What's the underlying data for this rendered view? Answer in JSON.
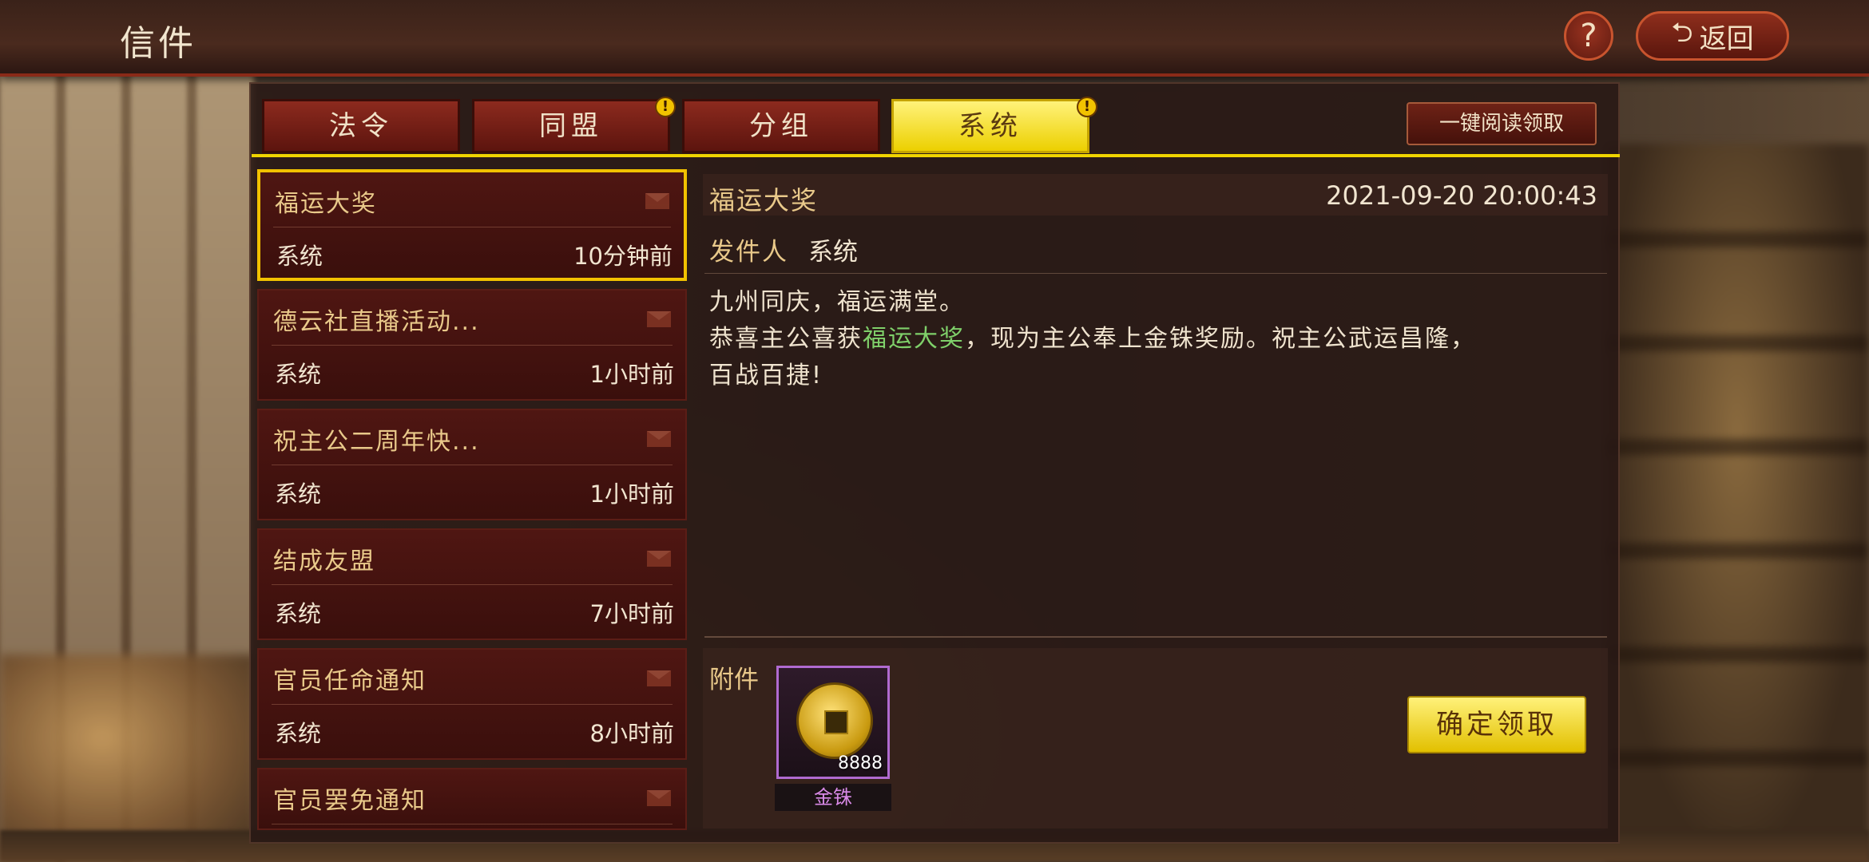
{
  "header": {
    "title": "信件",
    "help_label": "?",
    "back_label": "返回",
    "back_icon": "return-arrow-icon"
  },
  "tabs": [
    {
      "label": "法令",
      "active": false,
      "badge": ""
    },
    {
      "label": "同盟",
      "active": false,
      "badge": "!"
    },
    {
      "label": "分组",
      "active": false,
      "badge": ""
    },
    {
      "label": "系统",
      "active": true,
      "badge": "!"
    }
  ],
  "read_all_label": "一键阅读领取",
  "mail_list": [
    {
      "title": "福运大奖",
      "sender": "系统",
      "time": "10分钟前",
      "selected": true
    },
    {
      "title": "德云社直播活动...",
      "sender": "系统",
      "time": "1小时前",
      "selected": false
    },
    {
      "title": "祝主公二周年快...",
      "sender": "系统",
      "time": "1小时前",
      "selected": false
    },
    {
      "title": "结成友盟",
      "sender": "系统",
      "time": "7小时前",
      "selected": false
    },
    {
      "title": "官员任命通知",
      "sender": "系统",
      "time": "8小时前",
      "selected": false
    },
    {
      "title": "官员罢免通知",
      "sender": "",
      "time": "",
      "selected": false
    }
  ],
  "detail": {
    "title": "福运大奖",
    "datetime": "2021-09-20 20:00:43",
    "sender_label": "发件人",
    "sender": "系统",
    "body_line1": "九州同庆，福运满堂。",
    "body_line2_prefix": "恭喜主公喜获",
    "body_highlight": "福运大奖",
    "body_line2_suffix": "，现为主公奉上金铢奖励。祝主公武运昌隆，",
    "body_line3": "百战百捷!",
    "highlight_color": "#7fd06a"
  },
  "attachment": {
    "label": "附件",
    "item_name": "金铢",
    "item_count": "8888",
    "item_icon": "gold-coin-icon"
  },
  "claim_label": "确定领取",
  "colors": {
    "accent_yellow": "#f0d400",
    "tab_red": "#8c2a1e",
    "title_gold": "#e9c98a"
  }
}
